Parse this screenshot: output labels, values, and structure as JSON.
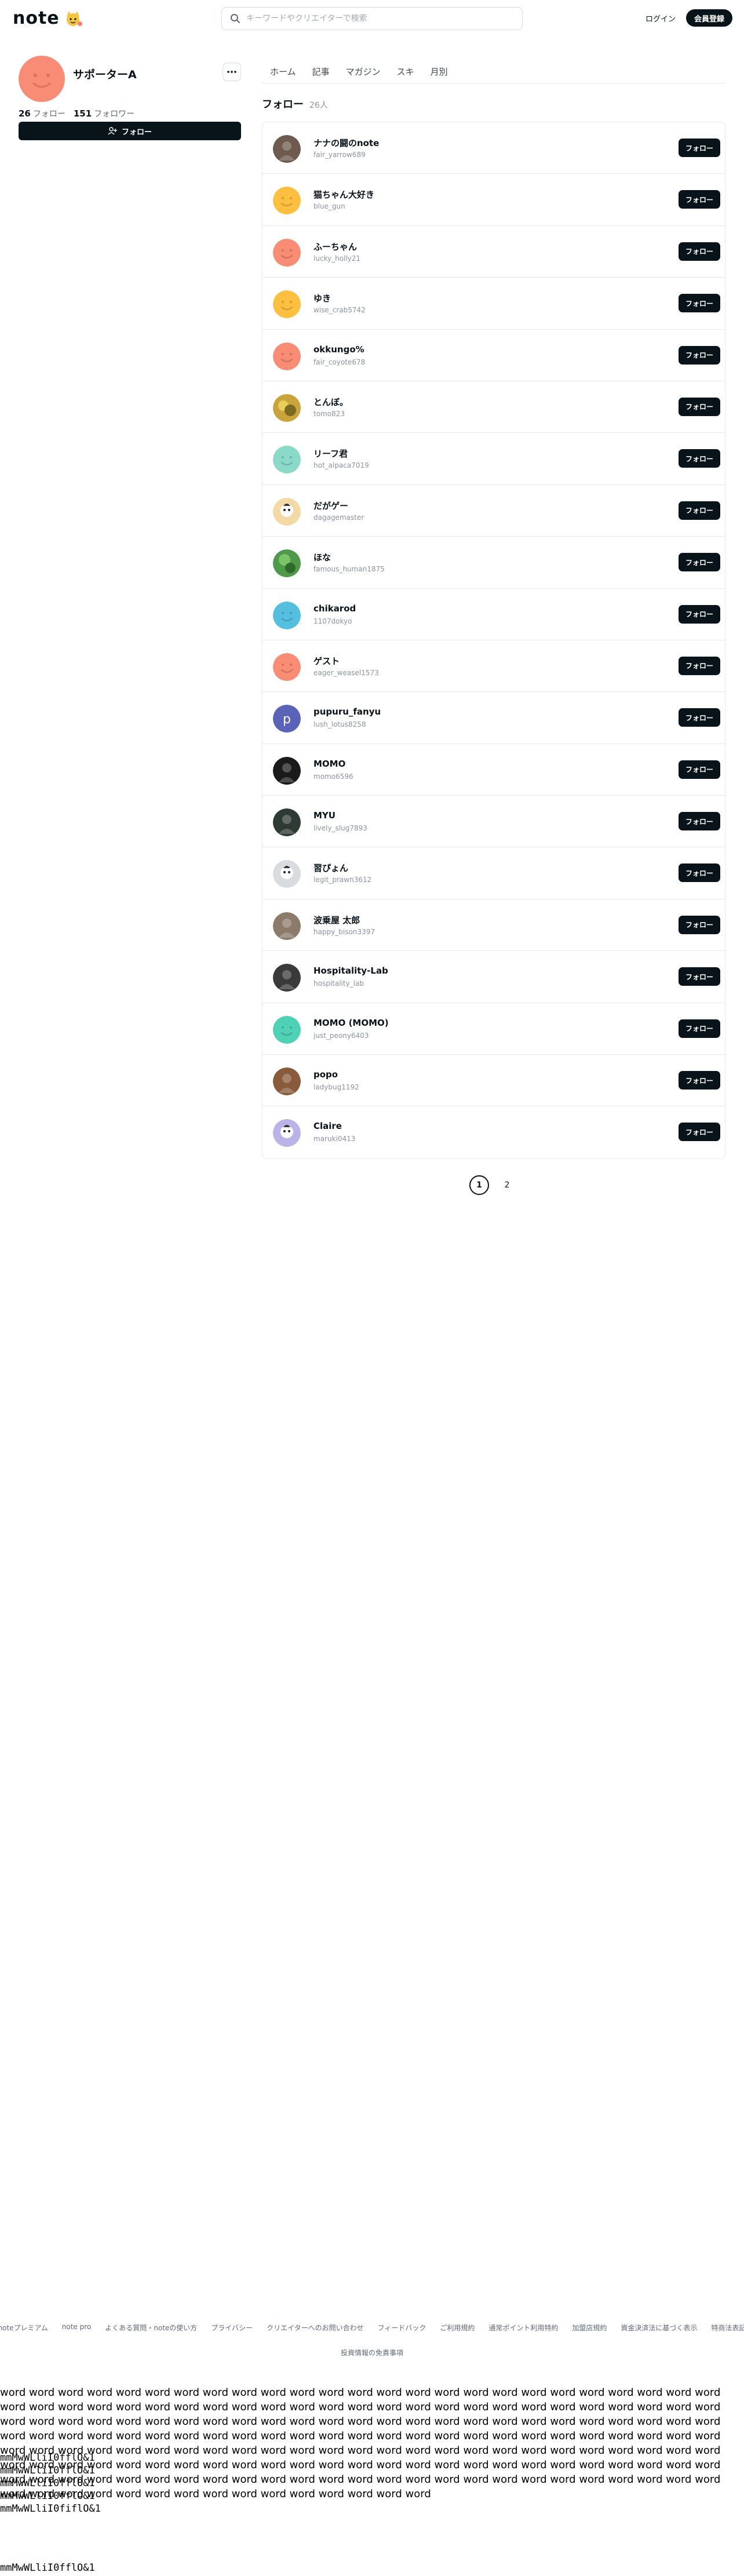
{
  "header": {
    "logo_text": "note",
    "search_placeholder": "キーワードやクリエイターで検索",
    "login_label": "ログイン",
    "signup_label": "会員登録"
  },
  "profile": {
    "name": "サポーターA",
    "follows_count": "26",
    "follows_label": "フォロー",
    "followers_count": "151",
    "followers_label": "フォロワー",
    "follow_button_label": "フォロー",
    "avatar_color": "#f98c74"
  },
  "tabs": [
    "ホーム",
    "記事",
    "マガジン",
    "スキ",
    "月別"
  ],
  "section": {
    "title": "フォロー",
    "count": "26人"
  },
  "follow_button_label": "フォロー",
  "follows": [
    {
      "name": "ナナの闘のnote",
      "id": "fair_yarrow689",
      "avatar": "photo-dark",
      "color": "#6e5a4e"
    },
    {
      "name": "猫ちゃん大好き",
      "id": "blue_gun",
      "avatar": "smile",
      "color": "#fdbf3f"
    },
    {
      "name": "ふーちゃん",
      "id": "lucky_holly21",
      "avatar": "smile",
      "color": "#f98c74"
    },
    {
      "name": "ゆき",
      "id": "wise_crab5742",
      "avatar": "smile",
      "color": "#fdbf3f"
    },
    {
      "name": "okkungo%",
      "id": "fair_coyote678",
      "avatar": "smile",
      "color": "#f98c74"
    },
    {
      "name": "とんぼ。",
      "id": "tomo823",
      "avatar": "photo-yellow",
      "color": "#c9a43a"
    },
    {
      "name": "リーフ君",
      "id": "hot_alpaca7019",
      "avatar": "smile",
      "color": "#8ad9c9"
    },
    {
      "name": "だがゲー",
      "id": "dagagemaster",
      "avatar": "photo-cartoon",
      "color": "#f2d9a6"
    },
    {
      "name": "ほな",
      "id": "famous_human1875",
      "avatar": "photo-green",
      "color": "#4f9a4a"
    },
    {
      "name": "chikarod",
      "id": "1107dokyo",
      "avatar": "smile",
      "color": "#55bfe0"
    },
    {
      "name": "ゲスト",
      "id": "eager_weasel1573",
      "avatar": "smile",
      "color": "#f98c74"
    },
    {
      "name": "pupuru_fanyu",
      "id": "lush_lotus8258",
      "avatar": "letter",
      "letter": "p",
      "color": "#5b63b8"
    },
    {
      "name": "MOMO",
      "id": "momo6596",
      "avatar": "photo-dark",
      "color": "#1a1a1a"
    },
    {
      "name": "MYU",
      "id": "lively_slug7893",
      "avatar": "photo-dark",
      "color": "#2e3a34"
    },
    {
      "name": "習ぴょん",
      "id": "legit_prawn3612",
      "avatar": "photo-cartoon",
      "color": "#d8dcdf"
    },
    {
      "name": "波乗屋 太郎",
      "id": "happy_bison3397",
      "avatar": "photo-dark",
      "color": "#8c7a6a"
    },
    {
      "name": "Hospitality-Lab",
      "id": "hospitality_lab",
      "avatar": "photo-dark",
      "color": "#3a3a3a"
    },
    {
      "name": "MOMO (MOMO)",
      "id": "just_peony6403",
      "avatar": "smile",
      "color": "#4fd1b6"
    },
    {
      "name": "popo",
      "id": "ladybug1192",
      "avatar": "photo-dark",
      "color": "#8a5a3c"
    },
    {
      "name": "Claire",
      "id": "maruki0413",
      "avatar": "photo-cartoon",
      "color": "#b9b3e8"
    }
  ],
  "pagination": {
    "pages": [
      "1",
      "2"
    ],
    "current": "1"
  },
  "footer": {
    "links": [
      "noteプレミアム",
      "note pro",
      "よくある質問・noteの使い方",
      "プライバシー",
      "クリエイターへのお問い合わせ",
      "フィードバック",
      "ご利用規約",
      "通常ポイント利用特約",
      "加盟店規約",
      "資金決済法に基づく表示",
      "特商法表記"
    ],
    "sub_link": "投資情報の免責事項"
  },
  "text_probe": "word word word word word word word word word word word word word word word word word word word word word word word word word word word word word word word word word word word word word word word word word word word word word word word word word word word word word word word word word word word word word word word word word word word word word word word word word word word word word word word word word word word word word word word word word word word word word word word word word word word word word word word word word word word word word word word word word word word word word word word word word word word word word word word word word word word word word word word word word word word word word word word word word word word word word word word word word word word word word word word word word word word word word word word word word word word word word word word word word word word word word word word word word word word word word word",
  "mono_probes": [
    "mmMwWLliI0fflO&1",
    "mmMwWLliI0fflO&1",
    "mmMwWLliI0fflO&1",
    "mmMwWLliI0fflO&1",
    "mmMwWLliI0fiflO&1",
    "mmMwWLliI0fflO&1"
  ]
}
